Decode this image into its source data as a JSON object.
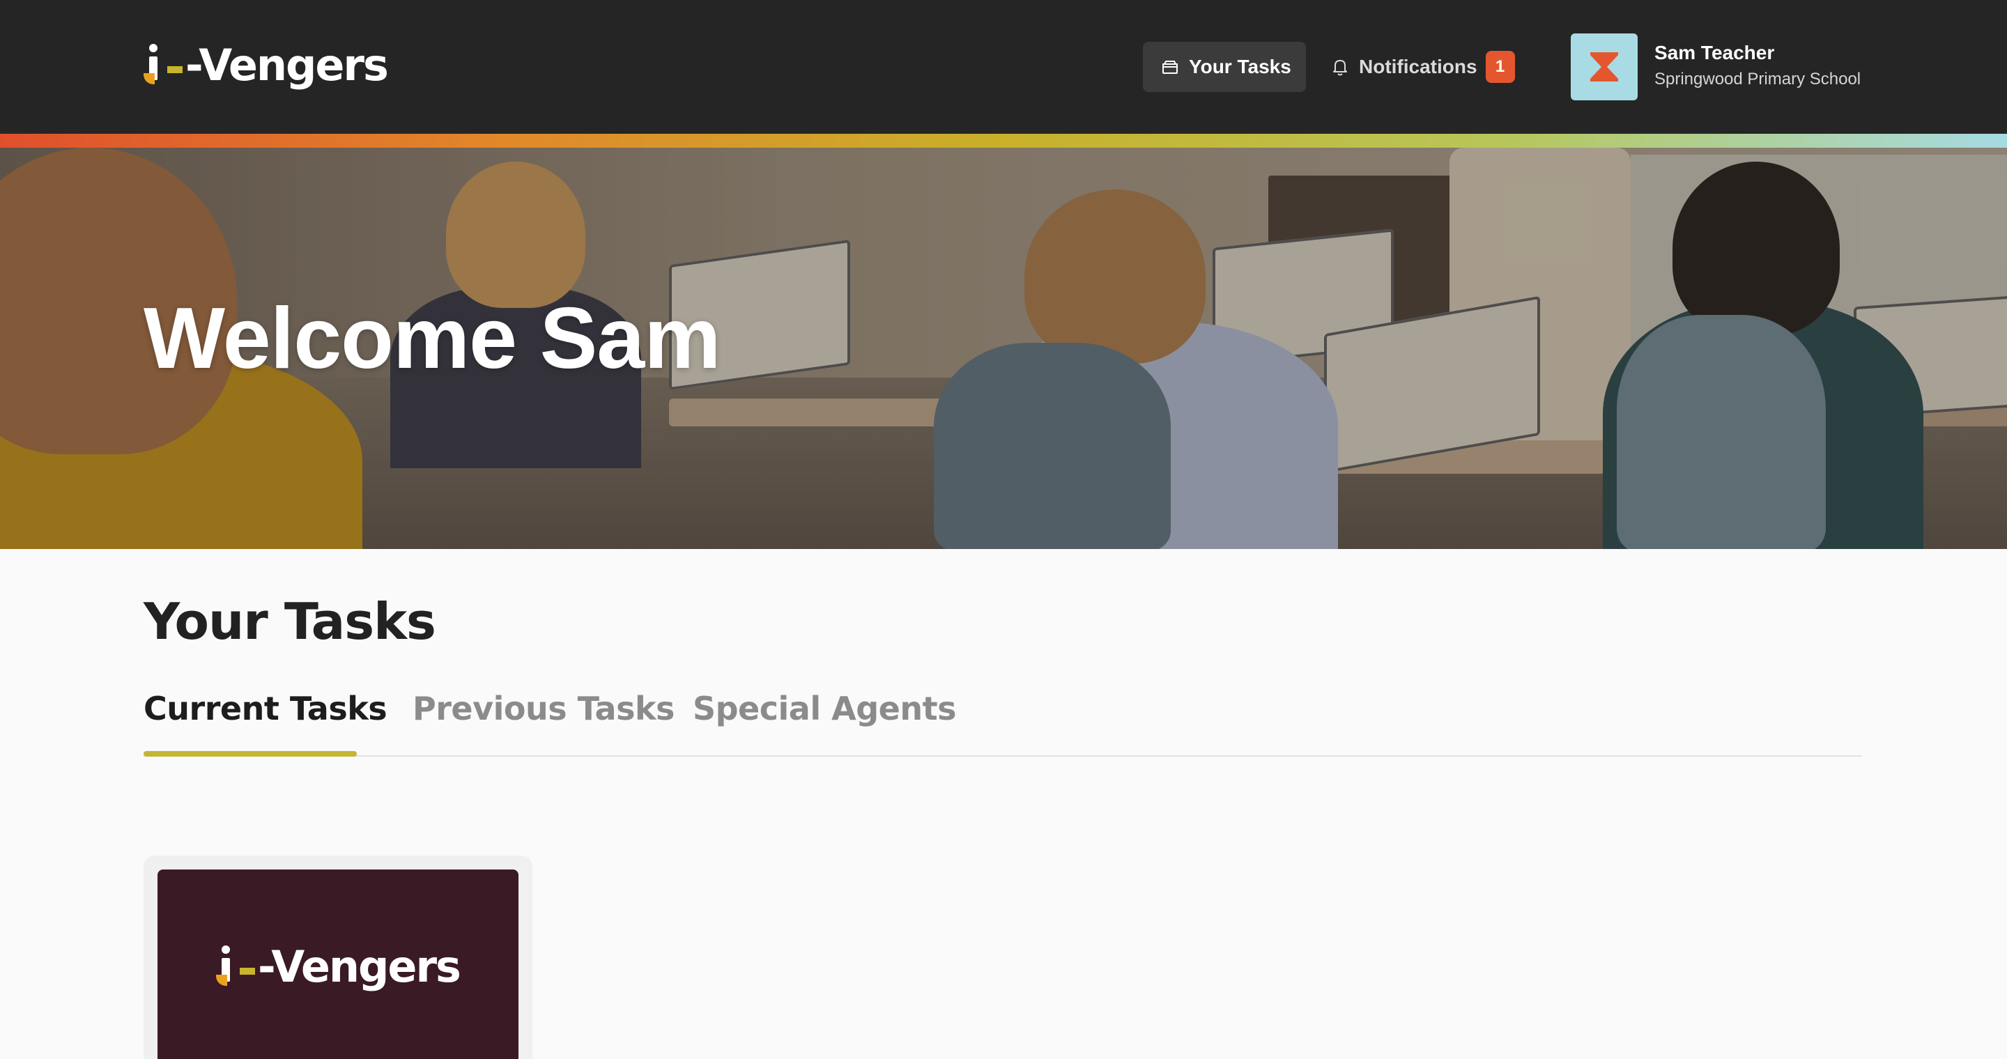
{
  "header": {
    "logo_text": "-Vengers",
    "logo_letter": "i",
    "nav": {
      "your_tasks_label": "Your Tasks",
      "notifications_label": "Notifications",
      "notifications_count": "1"
    },
    "user": {
      "name": "Sam Teacher",
      "school": "Springwood Primary School"
    }
  },
  "hero": {
    "welcome_text": "Welcome Sam"
  },
  "tasks": {
    "title": "Your Tasks",
    "tabs": [
      {
        "label": "Current Tasks",
        "active": true
      },
      {
        "label": "Previous Tasks",
        "active": false
      },
      {
        "label": "Special Agents",
        "active": false
      }
    ],
    "cards": [
      {
        "logo_text": "-Vengers"
      }
    ]
  },
  "colors": {
    "header_bg": "#252525",
    "accent_orange": "#e4572e",
    "accent_olive": "#c4b533",
    "avatar_bg": "#a9dbe5",
    "card_bg": "#3a1a25"
  },
  "icons": {
    "tasks": "folder-icon",
    "notifications": "bell-icon",
    "avatar": "hourglass-icon"
  }
}
